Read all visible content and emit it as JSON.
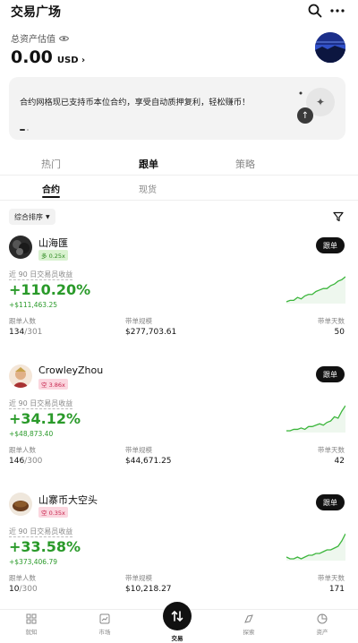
{
  "header": {
    "title": "交易广场"
  },
  "assets": {
    "label": "总资产估值",
    "value": "0.00",
    "currency": "USD"
  },
  "banner": {
    "text": "合约网格现已支持币本位合约，享受自动质押复利，轻松赚币！"
  },
  "tabs": [
    {
      "label": "热门"
    },
    {
      "label": "跟单"
    },
    {
      "label": "策略"
    }
  ],
  "subtabs": [
    {
      "label": "合约"
    },
    {
      "label": "现货"
    }
  ],
  "filter": {
    "label": "综合排序"
  },
  "labels": {
    "roi_label": "近 90 日交易员收益",
    "followers": "跟单人数",
    "aum": "带单规模",
    "days": "带单天数",
    "follow_button": "跟单"
  },
  "traders": [
    {
      "name": "山海匯",
      "badge": "多 0.25x",
      "roi": "+110.20%",
      "pnl": "+$111,463.25",
      "followers": "134",
      "followers_max": "/301",
      "aum": "$277,703.61",
      "days": "50",
      "spark": [
        3,
        4,
        4,
        6,
        5,
        7,
        8,
        8,
        10,
        11,
        12,
        12,
        14,
        15,
        17,
        18,
        20
      ]
    },
    {
      "name": "CrowleyZhou",
      "badge": "空 3.86x",
      "roi": "+34.12%",
      "pnl": "+$48,873.40",
      "followers": "146",
      "followers_max": "/300",
      "aum": "$44,671.25",
      "days": "42",
      "spark": [
        2,
        2,
        3,
        3,
        4,
        3,
        5,
        5,
        6,
        7,
        6,
        8,
        9,
        12,
        11,
        16,
        20
      ]
    },
    {
      "name": "山寨币大空头",
      "badge": "空 0.35x",
      "roi": "+33.58%",
      "pnl": "+$373,406.79",
      "followers": "10",
      "followers_max": "/300",
      "aum": "$10,218.27",
      "days": "171",
      "spark": [
        3,
        2,
        2,
        3,
        2,
        3,
        4,
        4,
        5,
        5,
        6,
        7,
        7,
        8,
        9,
        12,
        16
      ]
    }
  ],
  "bottom_nav": [
    {
      "label": "就知"
    },
    {
      "label": "市场"
    },
    {
      "label": "交易"
    },
    {
      "label": "探索"
    },
    {
      "label": "资产"
    }
  ]
}
